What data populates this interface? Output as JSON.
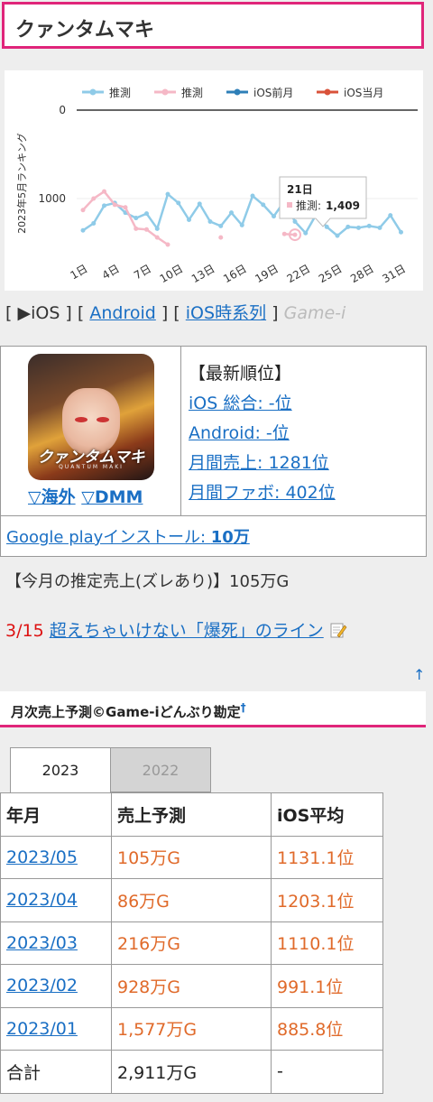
{
  "title": "クァンタムマキ",
  "chart_data": {
    "type": "line",
    "ylabel": "2023年5月ランキング",
    "yticks": [
      "0",
      "1000"
    ],
    "ylim": [
      0,
      1500
    ],
    "legend_position": "top",
    "x_tick_labels": [
      "1日",
      "4日",
      "7日",
      "10日",
      "13日",
      "16日",
      "19日",
      "22日",
      "25日",
      "28日",
      "31日"
    ],
    "days": [
      1,
      2,
      3,
      4,
      5,
      6,
      7,
      8,
      9,
      10,
      11,
      12,
      13,
      14,
      15,
      16,
      17,
      18,
      19,
      20,
      21,
      22,
      23,
      24,
      25,
      26,
      27,
      28,
      29,
      30,
      31
    ],
    "series": [
      {
        "name": "推測",
        "color": "#8fcbe8",
        "values": [
          1360,
          1280,
          1080,
          1050,
          1160,
          1220,
          1170,
          1340,
          950,
          1050,
          1240,
          1060,
          1260,
          1310,
          1160,
          1300,
          970,
          1070,
          1200,
          1030,
          1260,
          1390,
          1180,
          1320,
          1420,
          1320,
          1330,
          1310,
          1330,
          1190,
          1380
        ]
      },
      {
        "name": "推測",
        "color": "#f5b8c6",
        "values": [
          1130,
          1000,
          920,
          1070,
          1100,
          1340,
          1350,
          1440,
          1520,
          null,
          null,
          null,
          null,
          1440,
          null,
          null,
          null,
          null,
          null,
          1400,
          1409,
          null,
          null,
          null,
          null,
          null,
          null,
          null,
          null,
          null,
          null
        ]
      },
      {
        "name": "iOS前月",
        "color": "#2e7fb8",
        "values": []
      },
      {
        "name": "iOS当月",
        "color": "#d9523a",
        "values": []
      }
    ],
    "tooltip": {
      "day_label": "21日",
      "series_label": "推測:",
      "value_text": "1,409"
    }
  },
  "platform": {
    "open": "[",
    "ios": "▶iOS",
    "sep1": "] [",
    "android": "Android",
    "sep2": "] [",
    "ios_timeseries": "iOS時系列",
    "close": "]",
    "source": "Game-i"
  },
  "app_icon": {
    "logo_text": "クァンタムマキ",
    "logo_sub": "QUANTUM MAKI"
  },
  "store_links": {
    "overseas": "▽海外",
    "dmm": "▽DMM"
  },
  "ranks": {
    "heading": "【最新順位】",
    "ios_overall": "iOS 総合: -位",
    "android": "Android: -位",
    "monthly_sales": "月間売上: 1281位",
    "monthly_fav": "月間ファボ: 402位"
  },
  "google_play": {
    "label": "Google playインストール: ",
    "value": "10万"
  },
  "sales_estimate": "【今月の推定売上(ズレあり)】105万G",
  "warning": {
    "date": "3/15",
    "link": "超えちゃいけない「爆死」のライン"
  },
  "up_arrow": "↑",
  "section": {
    "title": "月次売上予測©Game-iどんぶり勘定",
    "dagger": "†"
  },
  "tabs": [
    "2023",
    "2022"
  ],
  "table": {
    "headers": [
      "年月",
      "売上予測",
      "iOS平均"
    ],
    "rows": [
      [
        "2023/05",
        "105万G",
        "1131.1位"
      ],
      [
        "2023/04",
        "86万G",
        "1203.1位"
      ],
      [
        "2023/03",
        "216万G",
        "1110.1位"
      ],
      [
        "2023/02",
        "928万G",
        "991.1位"
      ],
      [
        "2023/01",
        "1,577万G",
        "885.8位"
      ]
    ],
    "total": [
      "合計",
      "2,911万G",
      "-"
    ]
  }
}
